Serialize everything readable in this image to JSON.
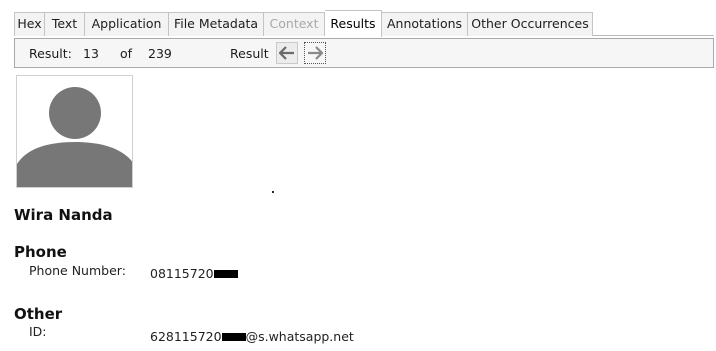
{
  "tabs": [
    {
      "label": "Hex",
      "state": "normal"
    },
    {
      "label": "Text",
      "state": "normal"
    },
    {
      "label": "Application",
      "state": "normal"
    },
    {
      "label": "File Metadata",
      "state": "normal"
    },
    {
      "label": "Context",
      "state": "disabled"
    },
    {
      "label": "Results",
      "state": "active"
    },
    {
      "label": "Annotations",
      "state": "normal"
    },
    {
      "label": "Other Occurrences",
      "state": "normal"
    }
  ],
  "nav": {
    "result_label": "Result:",
    "current": "13",
    "of_label": "of",
    "total": "239",
    "result_label2": "Result",
    "prev_icon": "arrow-left-icon",
    "next_icon": "arrow-right-icon"
  },
  "contact": {
    "name": "Wira Nanda",
    "phone": {
      "heading": "Phone",
      "label": "Phone Number:",
      "value_visible": "08115720"
    },
    "other": {
      "heading": "Other",
      "label": "ID:",
      "value_prefix": "628115720",
      "value_suffix": "@s.whatsapp.net"
    }
  },
  "colors": {
    "avatar": "#777777",
    "tab_bg": "#f3f3f3",
    "tab_disabled": "#a9a9a9",
    "redaction": "#000000"
  }
}
